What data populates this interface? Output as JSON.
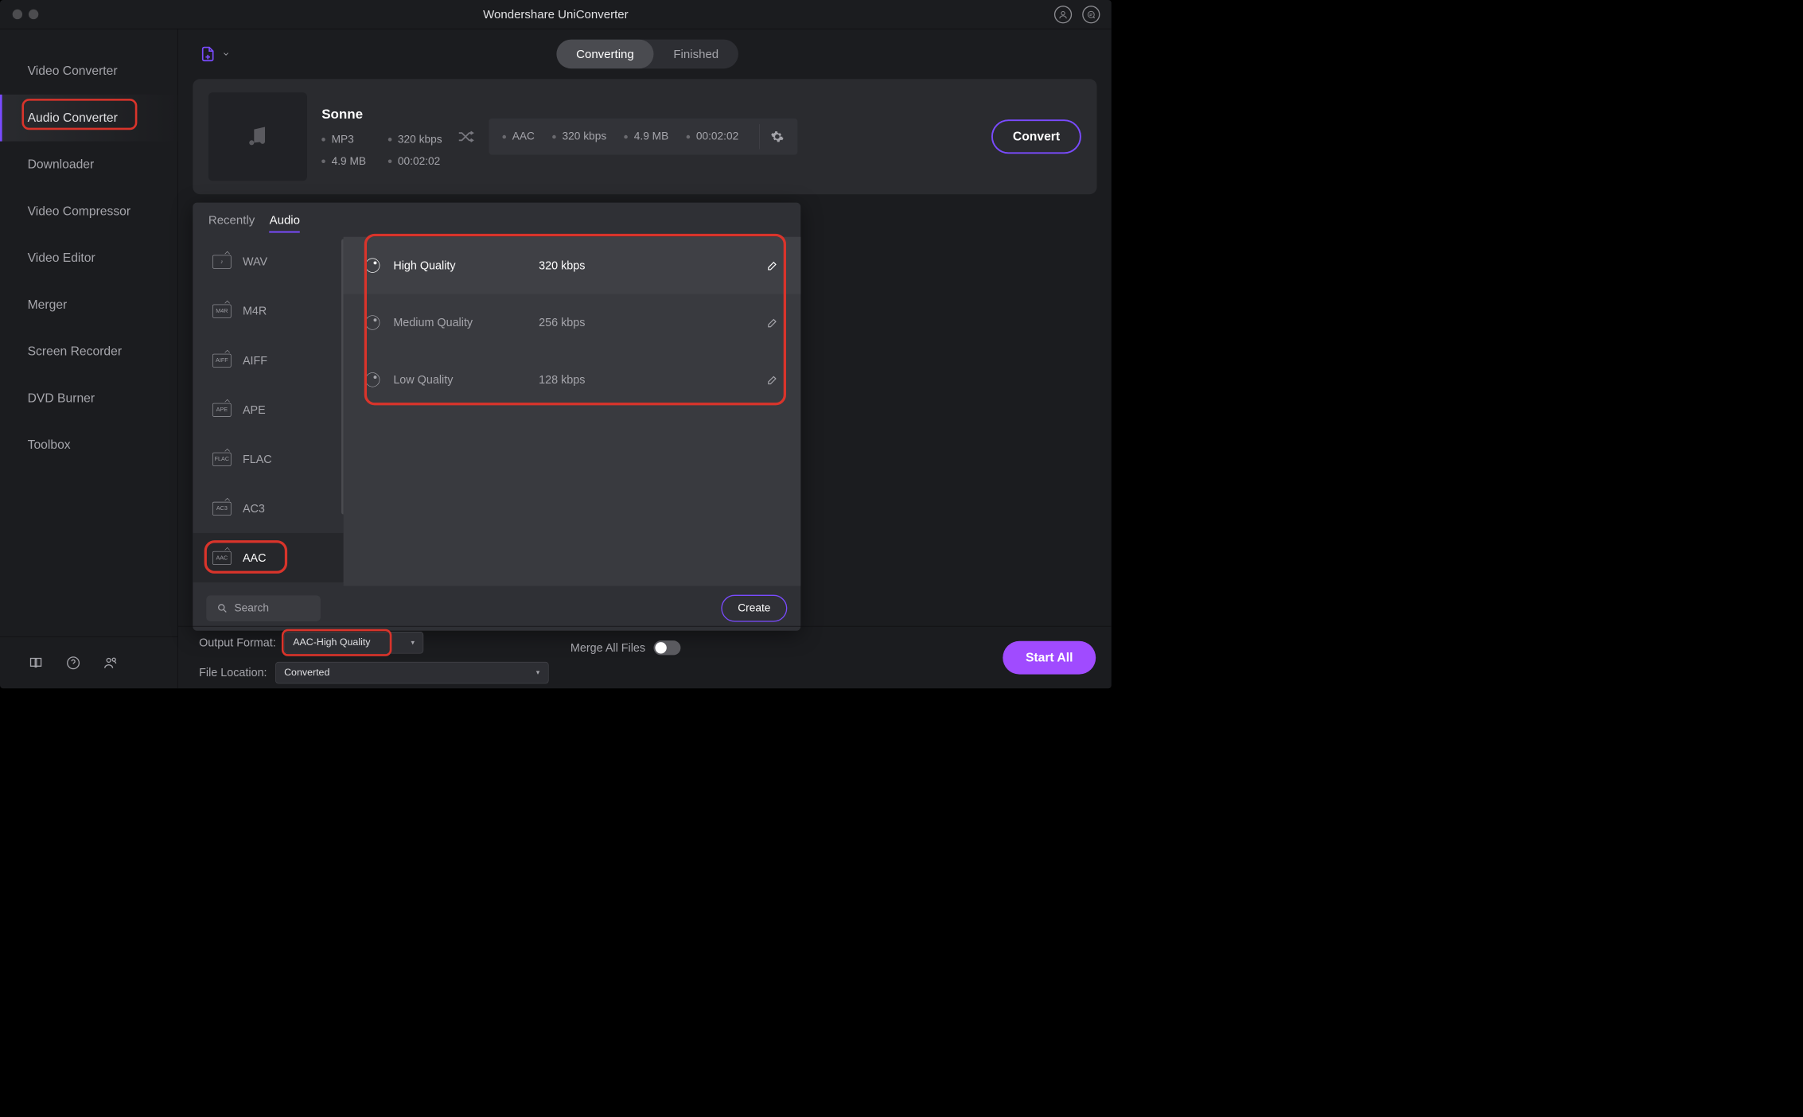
{
  "app": {
    "title": "Wondershare UniConverter"
  },
  "sidebar": {
    "items": [
      {
        "label": "Video Converter"
      },
      {
        "label": "Audio Converter"
      },
      {
        "label": "Downloader"
      },
      {
        "label": "Video Compressor"
      },
      {
        "label": "Video Editor"
      },
      {
        "label": "Merger"
      },
      {
        "label": "Screen Recorder"
      },
      {
        "label": "DVD Burner"
      },
      {
        "label": "Toolbox"
      }
    ]
  },
  "tabs": {
    "converting": "Converting",
    "finished": "Finished"
  },
  "file": {
    "name": "Sonne",
    "src_codec": "MP3",
    "src_bitrate": "320 kbps",
    "src_size": "4.9 MB",
    "src_dur": "00:02:02",
    "dst_codec": "AAC",
    "dst_bitrate": "320 kbps",
    "dst_size": "4.9 MB",
    "dst_dur": "00:02:02",
    "convert": "Convert"
  },
  "popover": {
    "recently": "Recently",
    "audio": "Audio",
    "formats": [
      "WAV",
      "M4R",
      "AIFF",
      "APE",
      "FLAC",
      "AC3",
      "AAC"
    ],
    "qualities": [
      {
        "label": "High Quality",
        "rate": "320 kbps"
      },
      {
        "label": "Medium Quality",
        "rate": "256 kbps"
      },
      {
        "label": "Low Quality",
        "rate": "128 kbps"
      }
    ],
    "search": "Search",
    "create": "Create"
  },
  "footer": {
    "of_label": "Output Format:",
    "of_value": "AAC-High Quality",
    "fl_label": "File Location:",
    "fl_value": "Converted",
    "merge": "Merge All Files",
    "startall": "Start All"
  }
}
